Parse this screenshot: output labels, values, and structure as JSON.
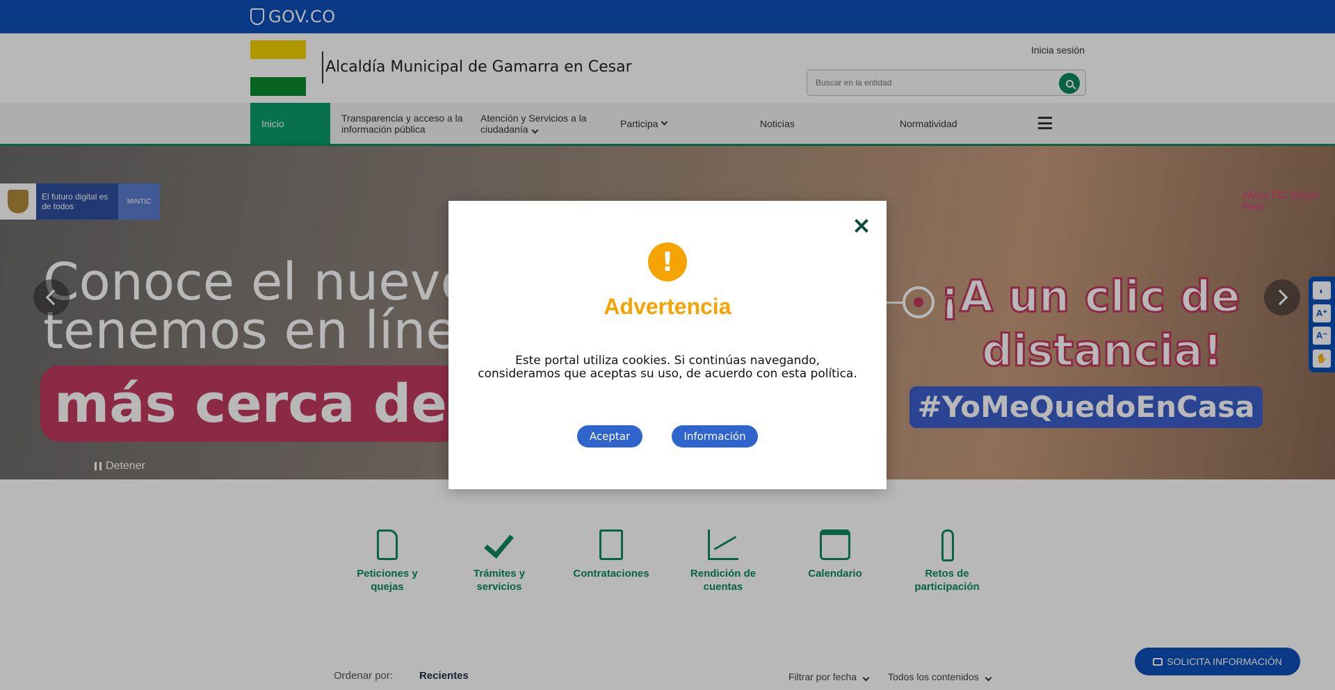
{
  "gov_bar": {
    "logo_text": "GOV.CO"
  },
  "header": {
    "entity_name": "Alcaldía Municipal de Gamarra en Cesar",
    "login_label": "Inicia sesión",
    "search_placeholder": "Buscar en la entidad"
  },
  "nav": {
    "items": [
      {
        "label": "Inicio"
      },
      {
        "label": "Transparencia y acceso a la información pública"
      },
      {
        "label": "Atención y Servicios a la ciudadanía"
      },
      {
        "label": "Participa"
      },
      {
        "label": "Noticias"
      },
      {
        "label": "Normatividad"
      }
    ]
  },
  "hero": {
    "mintic_text": "El futuro digital es de todos",
    "mintic_short": "MINTIC",
    "line1": "Conoce el nuevo",
    "line2": "tenemos en línea",
    "pill": "más cerca de",
    "right_line1": "¡A un clic de",
    "right_line2": "distancia!",
    "hashtag": "#YoMeQuedoEnCasa",
    "brand": "#MásTIC Mejor País",
    "stop_label": "Detener"
  },
  "services": [
    {
      "label": "Peticiones y quejas",
      "icon": "document-icon"
    },
    {
      "label": "Trámites y servicios",
      "icon": "checkmark-icon"
    },
    {
      "label": "Contrataciones",
      "icon": "checklist-icon"
    },
    {
      "label": "Rendición de cuentas",
      "icon": "chart-icon"
    },
    {
      "label": "Calendario",
      "icon": "calendar-icon"
    },
    {
      "label": "Retos de participación",
      "icon": "hand-icon"
    }
  ],
  "listing": {
    "sort_label": "Ordenar por:",
    "sort_value": "Recientes",
    "filter_date": "Filtrar por fecha",
    "filter_content": "Todos los contenidos",
    "solicita": "SOLICITA INFORMACIÓN"
  },
  "modal": {
    "title": "Advertencia",
    "icon_symbol": "!",
    "message": "Este portal utiliza cookies. Si continúas navegando, consideramos que aceptas su uso, de acuerdo con esta política.",
    "accept_label": "Aceptar",
    "info_label": "Información"
  },
  "colors": {
    "gov_blue": "#0d4fb7",
    "brand_green": "#0a8a5a",
    "warning_orange": "#f5a300",
    "button_blue": "#2f64cc"
  }
}
